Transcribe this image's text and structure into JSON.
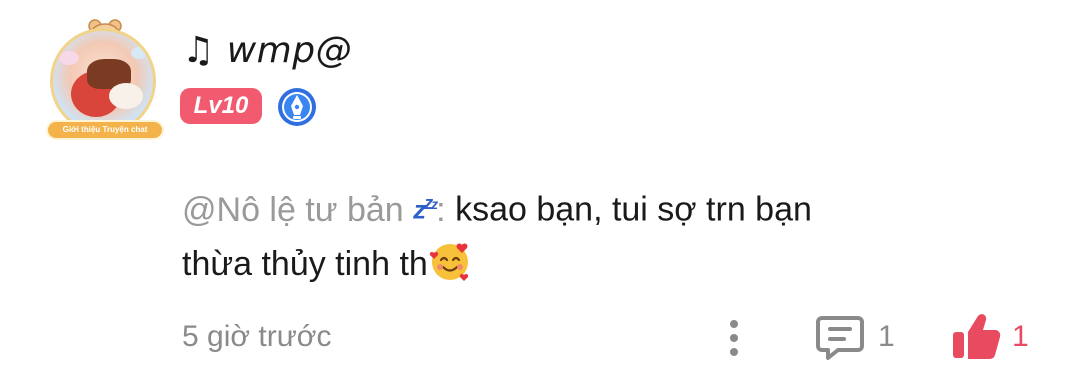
{
  "comment": {
    "author": {
      "name": "♫ wmp@",
      "level": "Lv10",
      "avatar_badge_text": "Giới thiệu Truyện chat",
      "icons": {
        "avatar": "avatar-image",
        "pen_badge": "pen-badge-icon"
      }
    },
    "mention": "@Nô lệ tư bản",
    "mention_emoji": "💤",
    "mention_separator": ":",
    "text_line1": " ksao bạn, tui sợ trn bạn",
    "text_line2": "thừa thủy tinh th",
    "text_emoji": "🥰",
    "time": "5 giờ trước",
    "actions": {
      "more_icon": "more-vertical-icon",
      "reply_icon": "comment-icon",
      "reply_count": "1",
      "like_icon": "thumbs-up-icon",
      "like_count": "1"
    }
  },
  "colors": {
    "level_badge": "#f15a6f",
    "mention": "#9a9a9a",
    "like": "#e84a5f",
    "muted": "#8a8a8a"
  }
}
